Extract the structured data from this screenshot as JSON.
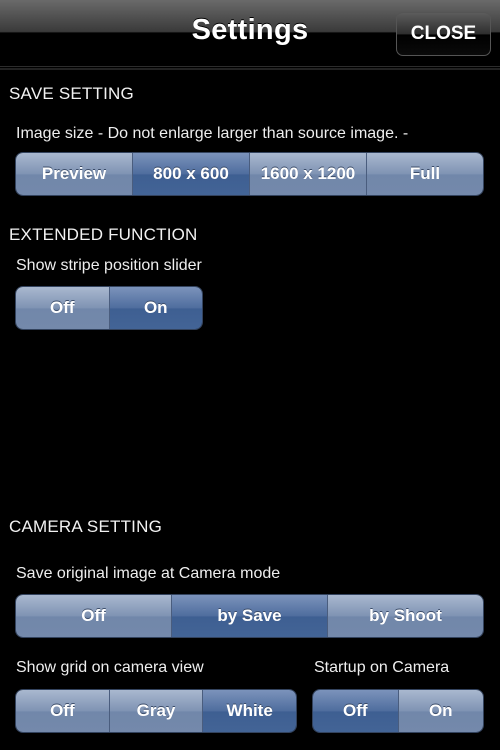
{
  "navbar": {
    "title": "Settings",
    "close_label": "CLOSE"
  },
  "save_setting": {
    "header": "SAVE SETTING",
    "image_size": {
      "label": "Image size - Do not enlarge larger than source image. -",
      "options": [
        "Preview",
        "800 x 600",
        "1600 x 1200",
        "Full"
      ],
      "selected": "800 x 600"
    }
  },
  "extended_function": {
    "header": "EXTENDED FUNCTION",
    "stripe_slider": {
      "label": "Show stripe position slider",
      "options": [
        "Off",
        "On"
      ],
      "selected": "On"
    }
  },
  "camera_setting": {
    "header": "CAMERA SETTING",
    "save_original": {
      "label": "Save original image at Camera mode",
      "options": [
        "Off",
        "by Save",
        "by Shoot"
      ],
      "selected": "by Save"
    },
    "grid": {
      "label": "Show grid on camera view",
      "options": [
        "Off",
        "Gray",
        "White"
      ],
      "selected": "White"
    },
    "startup": {
      "label": "Startup on Camera",
      "options": [
        "Off",
        "On"
      ],
      "selected": "Off"
    }
  }
}
